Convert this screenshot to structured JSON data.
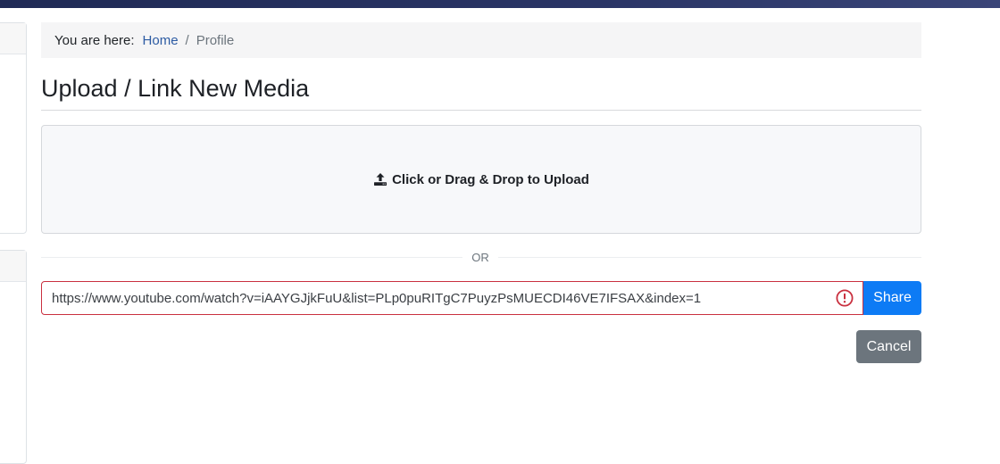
{
  "breadcrumb": {
    "prefix": "You are here:",
    "home": "Home",
    "separator": "/",
    "current": "Profile"
  },
  "page": {
    "title": "Upload / Link New Media"
  },
  "dropzone": {
    "icon": "upload-icon",
    "label": "Click or Drag & Drop to Upload"
  },
  "divider": {
    "label": "OR"
  },
  "link_form": {
    "url_value": "https://www.youtube.com/watch?v=iAAYGJjkFuU&list=PLp0puRITgC7PuyzPsMUECDI46VE7IFSAX&index=1",
    "status_icon": "error-icon",
    "error_color": "#c9303f",
    "share_label": "Share",
    "share_color": "#0d7bf5"
  },
  "actions": {
    "cancel_label": "Cancel",
    "cancel_color": "#6c757d"
  }
}
